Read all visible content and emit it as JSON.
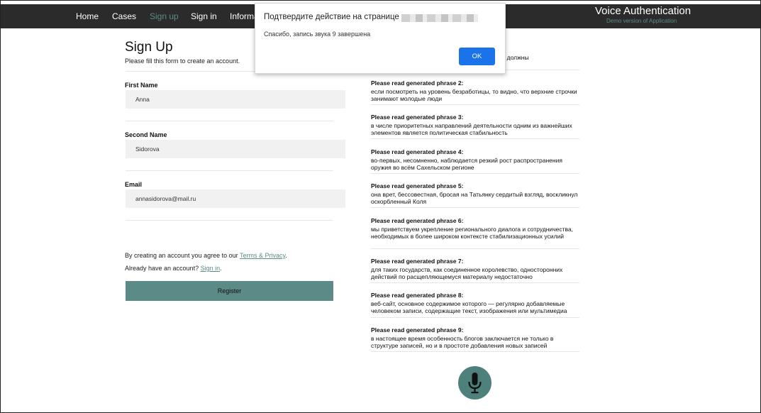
{
  "nav": {
    "items": [
      {
        "label": "Home"
      },
      {
        "label": "Cases"
      },
      {
        "label": "Sign up",
        "active": true
      },
      {
        "label": "Sign in"
      },
      {
        "label": "Informa"
      }
    ],
    "brand_title": "Voice Authentication",
    "brand_subtitle": "Demo version of Application"
  },
  "form": {
    "title": "Sign Up",
    "subtitle": "Please fill this form to create an account.",
    "first_name_label": "First Name",
    "first_name_value": "Anna",
    "second_name_label": "Second Name",
    "second_name_value": "Sidorova",
    "email_label": "Email",
    "email_value": "annasidorova@mail.ru",
    "terms_prefix": "By creating an account you agree to our ",
    "terms_link": "Terms & Privacy",
    "terms_suffix": ".",
    "signin_prefix": "Already have an account? ",
    "signin_link": "Sign in",
    "signin_suffix": ".",
    "register_label": "Register"
  },
  "phrases": {
    "partial_text": "ати лет, должны",
    "items": [
      {
        "label": "Please read generated phrase 2:",
        "text": "если посмотреть на уровень безработицы, то видно, что верхние строчки занимают молодые люди"
      },
      {
        "label": "Please read generated phrase 3:",
        "text": "в числе приоритетных направлений деятельности одним из важнейших элементов является политическая стабильность"
      },
      {
        "label": "Please read generated phrase 4:",
        "text": "во-первых, несомненно, наблюдается резкий рост распространения оружия во всём Сахельском регионе"
      },
      {
        "label": "Please read generated phrase 5:",
        "text": "она врет, бессовестная, бросая на Татьянку сердитый взгляд, воскликнул оскорбленный Коля"
      },
      {
        "label": "Please read generated phrase 6:",
        "text": "мы приветствуем укрепление регионального диалога и сотрудничества, необходимых в более широком контексте стабилизационных усилий"
      },
      {
        "label": "Please read generated phrase 7:",
        "text": "для таких государств, как соединенное королевство, односторонних действий по расщепляющемуся материалу недостаточно"
      },
      {
        "label": "Please read generated phrase 8:",
        "text": "веб-сайт, основное содержимое которого — регулярно добавляемые человеком записи, содержащие текст, изображения или мультимедиа"
      },
      {
        "label": "Please read generated phrase 9:",
        "text": "в настоящее время особенность блогов заключается не только в структуре записей, но и в простоте добавления новых записей"
      }
    ]
  },
  "dialog": {
    "title": "Подтвердите действие на странице",
    "message": "Спасибо, запись звука 9 завершена",
    "ok_label": "OK"
  },
  "icons": {
    "mic": "microphone-icon"
  },
  "colors": {
    "accent": "#5b8a87",
    "navbar": "#2b2b2b",
    "mic_button": "#4e807c",
    "dialog_button": "#1a73e8",
    "input_bg": "#f1f1f1"
  }
}
